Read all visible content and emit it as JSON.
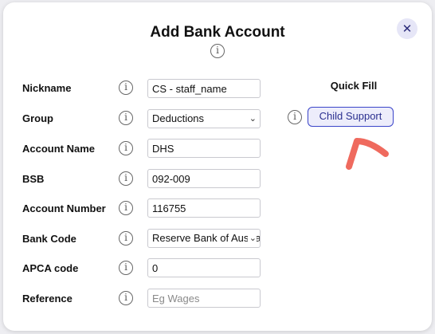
{
  "dialog": {
    "title": "Add Bank Account",
    "close_glyph": "✕",
    "info_glyph": "i"
  },
  "form": {
    "nickname": {
      "label": "Nickname",
      "value": "CS - staff_name"
    },
    "group": {
      "label": "Group",
      "value": "Deductions"
    },
    "account_name": {
      "label": "Account Name",
      "value": "DHS"
    },
    "bsb": {
      "label": "BSB",
      "value": "092-009"
    },
    "account_number": {
      "label": "Account Number",
      "value": "116755"
    },
    "bank_code": {
      "label": "Bank Code",
      "value": "Reserve Bank of Australia"
    },
    "apca_code": {
      "label": "APCA code",
      "value": "0"
    },
    "reference": {
      "label": "Reference",
      "value": "",
      "placeholder": "Eg Wages"
    }
  },
  "quick_fill": {
    "title": "Quick Fill",
    "child_support_label": "Child Support"
  },
  "icons": {
    "info": "info-icon",
    "close": "close-icon",
    "chevron": "chevron-down-icon",
    "annotation_arrow": "arrow-annotation-icon"
  },
  "colors": {
    "accent": "#3b45c9",
    "button_bg": "#ededfb",
    "annotation": "#ef6a5e"
  }
}
